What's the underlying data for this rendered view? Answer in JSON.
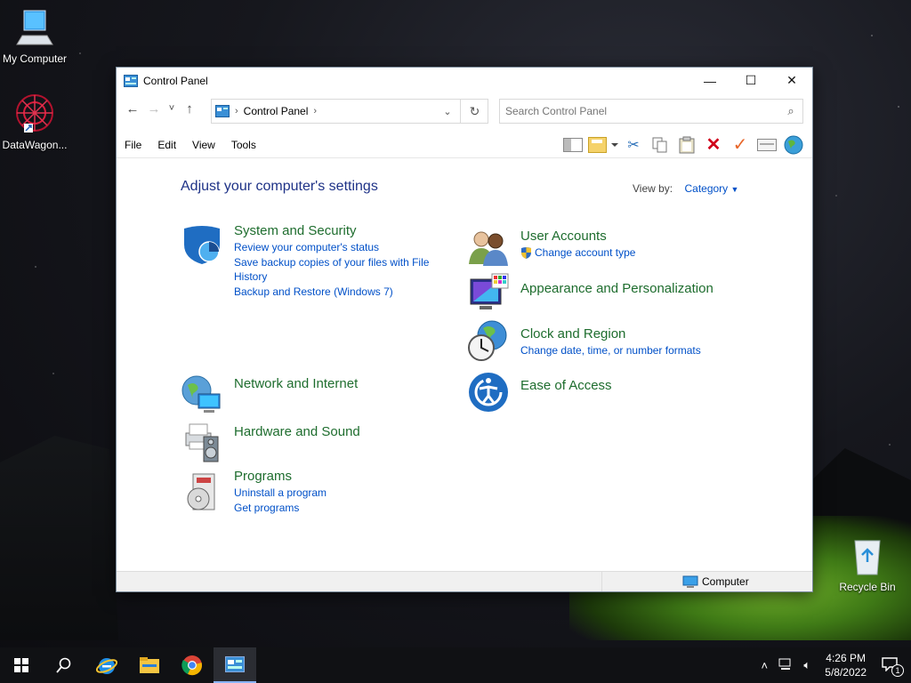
{
  "desktop": {
    "icons": [
      {
        "label": "My Computer",
        "icon": "computer-icon"
      },
      {
        "label": "DataWagon...",
        "icon": "datawagon-icon"
      },
      {
        "label": "Recycle Bin",
        "icon": "recycle-bin-icon"
      }
    ]
  },
  "window": {
    "title": "Control Panel",
    "controls": {
      "minimize": "—",
      "maximize": "☐",
      "close": "✕"
    },
    "nav": {
      "back": "←",
      "forward": "→",
      "recent": "˅",
      "up": "↑"
    },
    "address": {
      "crumb": "Control Panel"
    },
    "search": {
      "placeholder": "Search Control Panel",
      "value": ""
    },
    "menu": [
      "File",
      "Edit",
      "View",
      "Tools"
    ],
    "heading": "Adjust your computer's settings",
    "view_by": {
      "label": "View by:",
      "value": "Category"
    },
    "categories_left": [
      {
        "title": "System and Security",
        "links": [
          "Review your computer's status",
          "Save backup copies of your files with File History",
          "Backup and Restore (Windows 7)"
        ]
      },
      {
        "title": "Network and Internet",
        "links": []
      },
      {
        "title": "Hardware and Sound",
        "links": []
      },
      {
        "title": "Programs",
        "links": [
          "Uninstall a program",
          "Get programs"
        ]
      }
    ],
    "categories_right": [
      {
        "title": "User Accounts",
        "links": [
          "Change account type"
        ]
      },
      {
        "title": "Appearance and Personalization",
        "links": []
      },
      {
        "title": "Clock and Region",
        "links": [
          "Change date, time, or number formats"
        ]
      },
      {
        "title": "Ease of Access",
        "links": []
      }
    ],
    "status": {
      "computer": "Computer"
    }
  },
  "taskbar": {
    "time": "4:26 PM",
    "date": "5/8/2022",
    "notifications": "1"
  },
  "colors": {
    "title_green": "#1e6d2e",
    "link_blue": "#0050c8",
    "heading_blue": "#1e3287"
  }
}
